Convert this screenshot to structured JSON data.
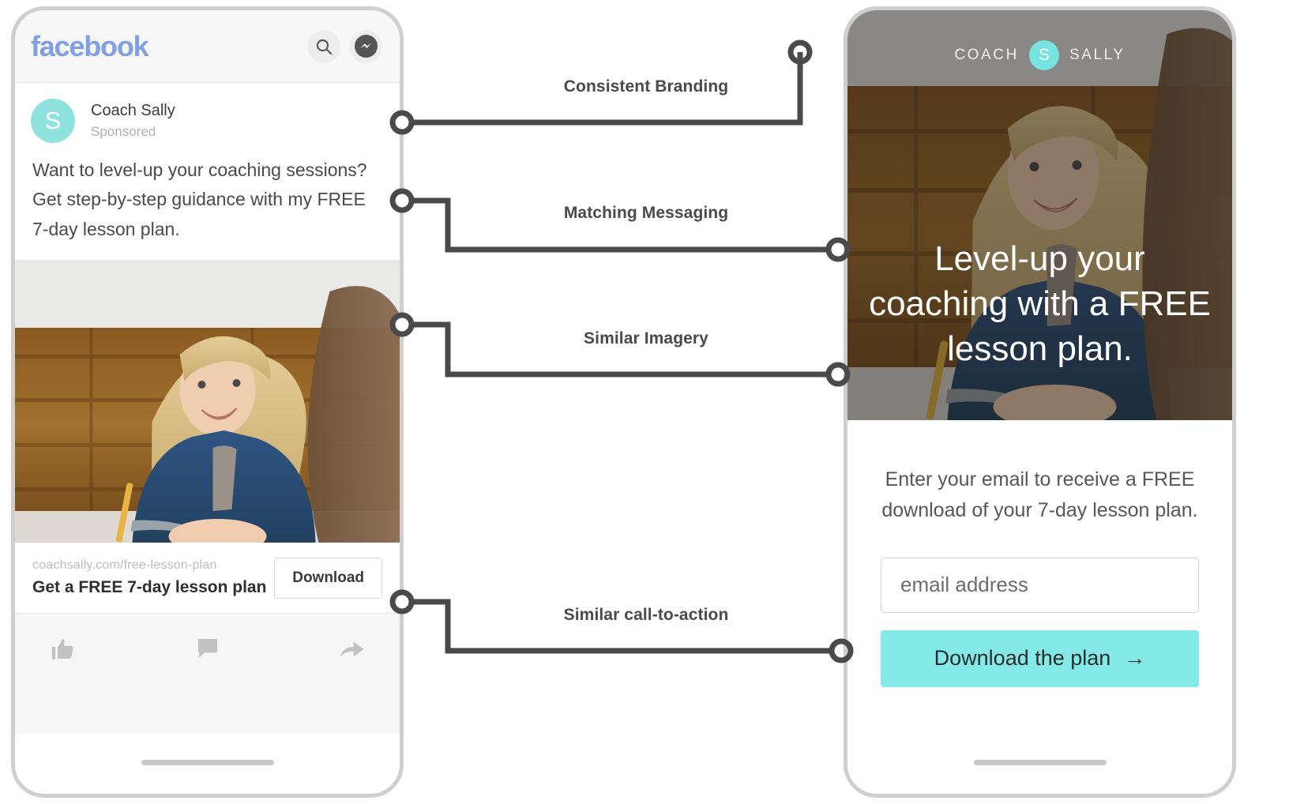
{
  "facebook_phone": {
    "app_name": "facebook",
    "search_icon": "search-icon",
    "messenger_icon": "messenger-icon",
    "post": {
      "avatar_letter": "S",
      "page_name": "Coach Sally",
      "label": "Sponsored",
      "body": "Want to level-up your coaching sessions? Get step-by-step guidance with my FREE 7-day lesson plan.",
      "link_url": "coachsally.com/free-lesson-plan",
      "link_headline": "Get a FREE 7-day lesson plan",
      "cta_label": "Download"
    },
    "actions": [
      {
        "name": "like-icon"
      },
      {
        "name": "comment-icon"
      },
      {
        "name": "share-icon"
      }
    ]
  },
  "landing_phone": {
    "brand_left": "COACH",
    "brand_badge": "S",
    "brand_right": "SALLY",
    "headline": "Level-up your coaching with a FREE lesson plan.",
    "subtext": "Enter your email to receive a FREE download of your 7-day lesson plan.",
    "email_placeholder": "email address",
    "email_value": "",
    "cta_label": "Download the plan",
    "cta_arrow": "→"
  },
  "annotations": [
    {
      "label": "Consistent Branding",
      "name": "annotation-consistent-branding"
    },
    {
      "label": "Matching Messaging",
      "name": "annotation-matching-messaging"
    },
    {
      "label": "Similar Imagery",
      "name": "annotation-similar-imagery"
    },
    {
      "label": "Similar call-to-action",
      "name": "annotation-similar-call-to-action"
    }
  ],
  "colors": {
    "accent_teal": "#84eae7",
    "avatar_teal": "#8fe3de",
    "facebook_blue": "#7fa0e8",
    "connector_gray": "#4a4a4a",
    "phone_bezel": "#cfcfcf"
  }
}
